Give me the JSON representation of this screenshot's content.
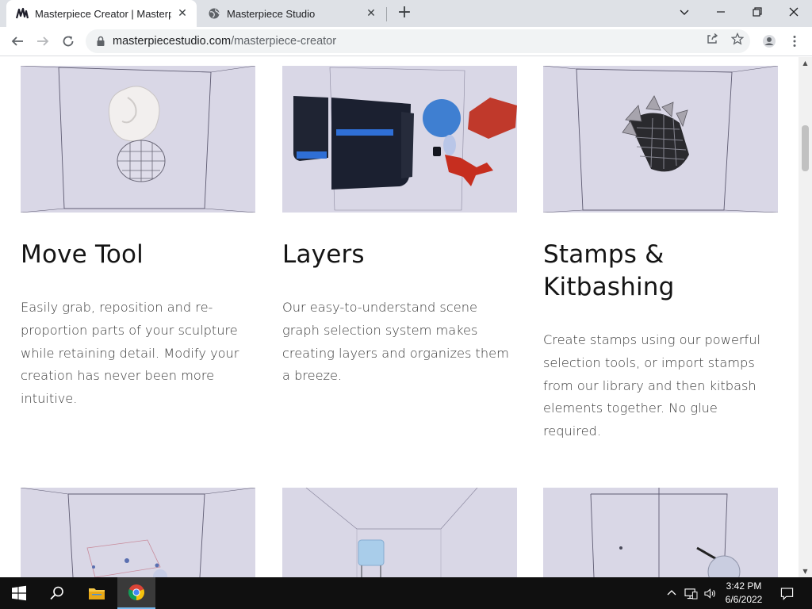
{
  "browser": {
    "tabs": [
      {
        "title": "Masterpiece Creator | Masterpiec",
        "active": true,
        "favicon": "masterpiece-logo-icon"
      },
      {
        "title": "Masterpiece Studio",
        "active": false,
        "favicon": "globe-icon"
      }
    ],
    "address": {
      "domain": "masterpiecestudio.com",
      "path": "/masterpiece-creator"
    }
  },
  "features": [
    {
      "title": "Move Tool",
      "description": "Easily grab, reposition and re-proportion parts of your sculpture while retaining detail. Modify your creation has never been more intuitive."
    },
    {
      "title": "Layers",
      "description": "Our easy-to-understand scene graph selection system makes creating layers and organizes them a breeze."
    },
    {
      "title": "Stamps & Kitbashing",
      "description": "Create stamps using our powerful selection tools, or import stamps from our library and then kitbash elements together. No glue required."
    }
  ],
  "taskbar": {
    "time": "3:42 PM",
    "date": "6/6/2022"
  },
  "colors": {
    "thumb_bg": "#d9d7e6",
    "accent": "#1a73e8",
    "taskbar": "#101010"
  }
}
